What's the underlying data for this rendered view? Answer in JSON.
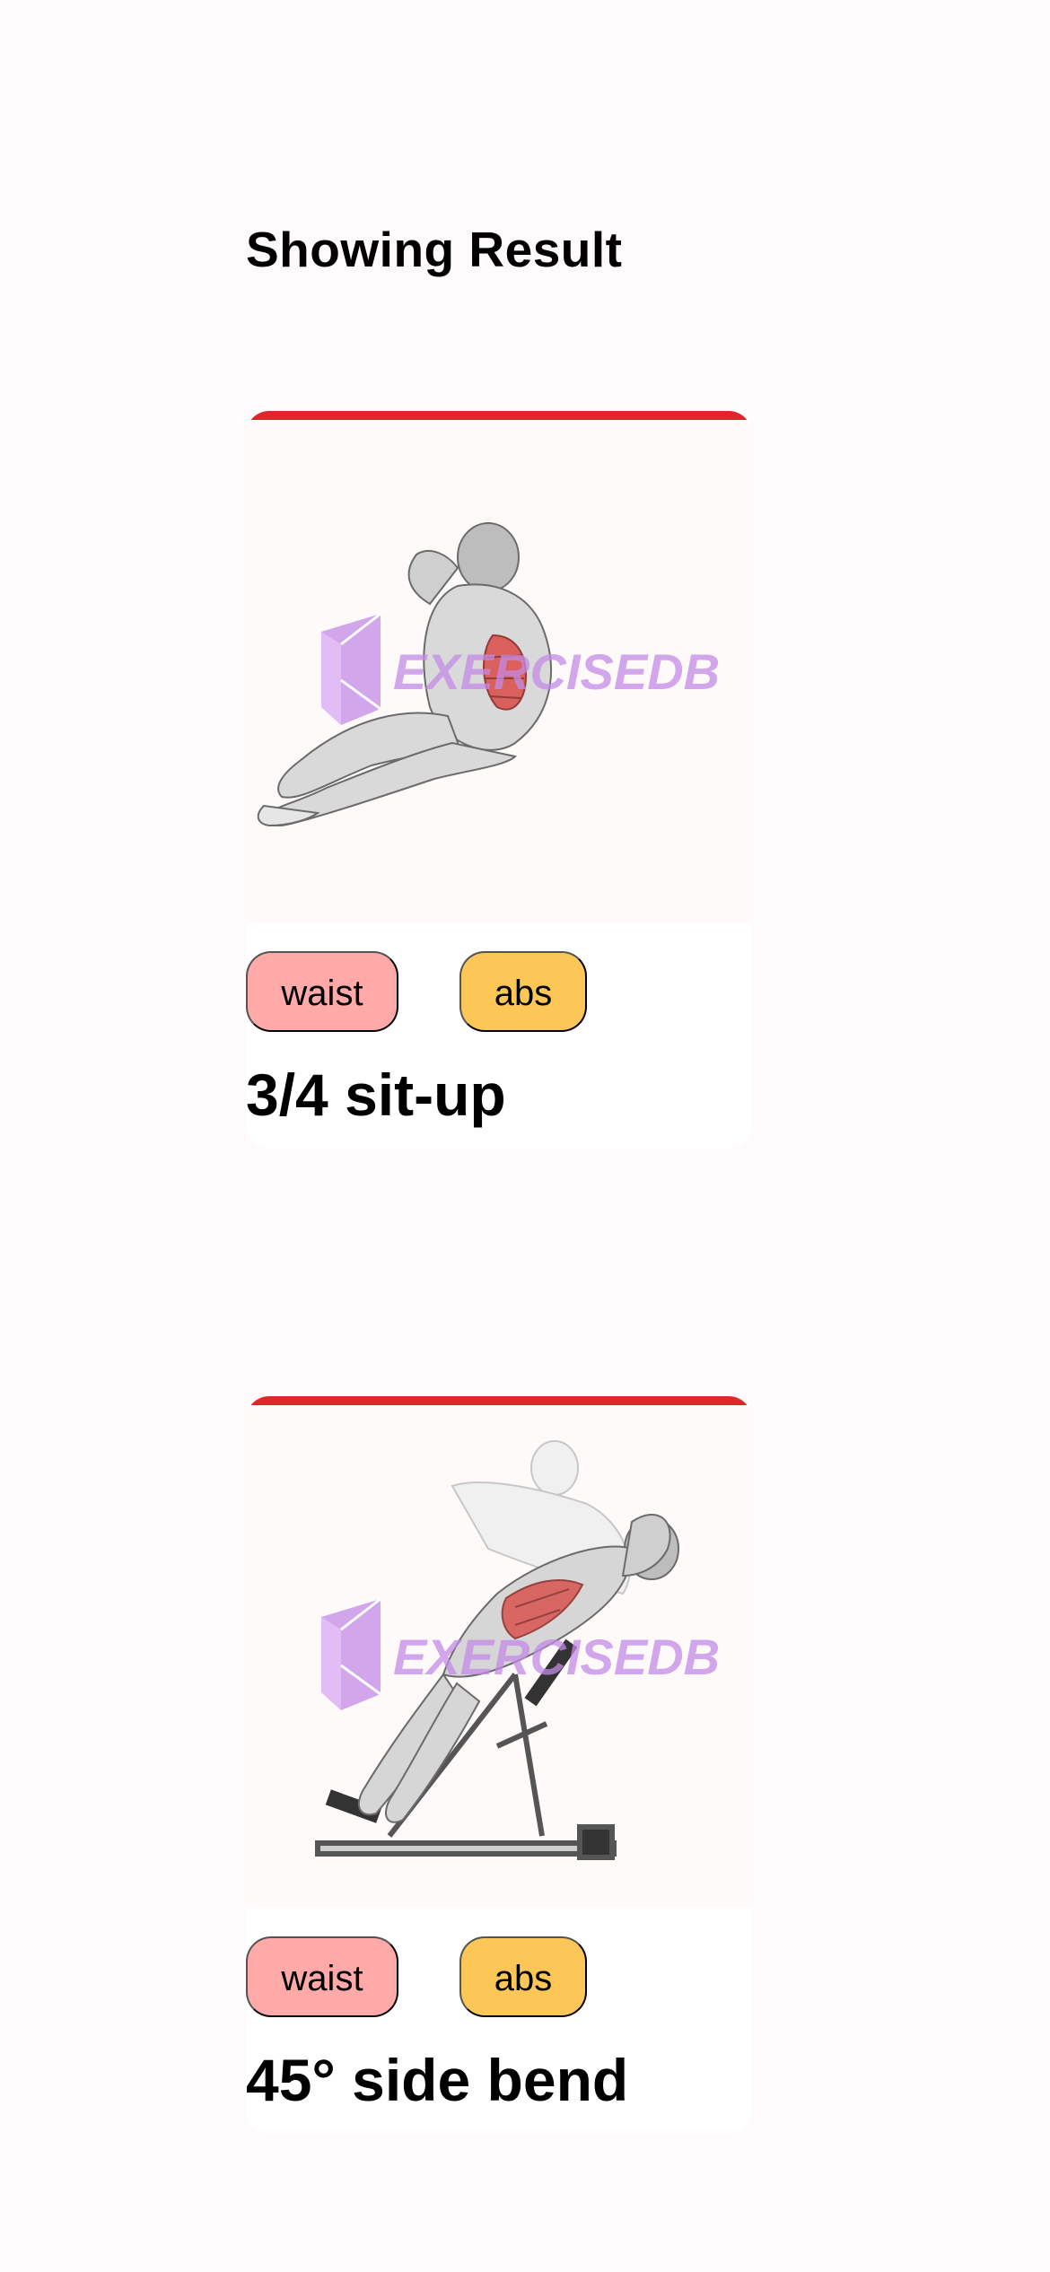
{
  "header": {
    "title": "Showing Result"
  },
  "watermark": {
    "brand": "EXERCISEDB",
    "color": "#c48be6"
  },
  "colors": {
    "card_accent": "#e0262b",
    "body_part_pill": "#ffa9a9",
    "target_pill": "#fcc757",
    "page_background": "#fffafb"
  },
  "results": [
    {
      "name": "3/4 sit-up",
      "body_part": "waist",
      "target": "abs",
      "image": "seated-crunch-figure"
    },
    {
      "name": "45° side bend",
      "body_part": "waist",
      "target": "abs",
      "image": "roman-chair-side-bend-figure"
    }
  ]
}
